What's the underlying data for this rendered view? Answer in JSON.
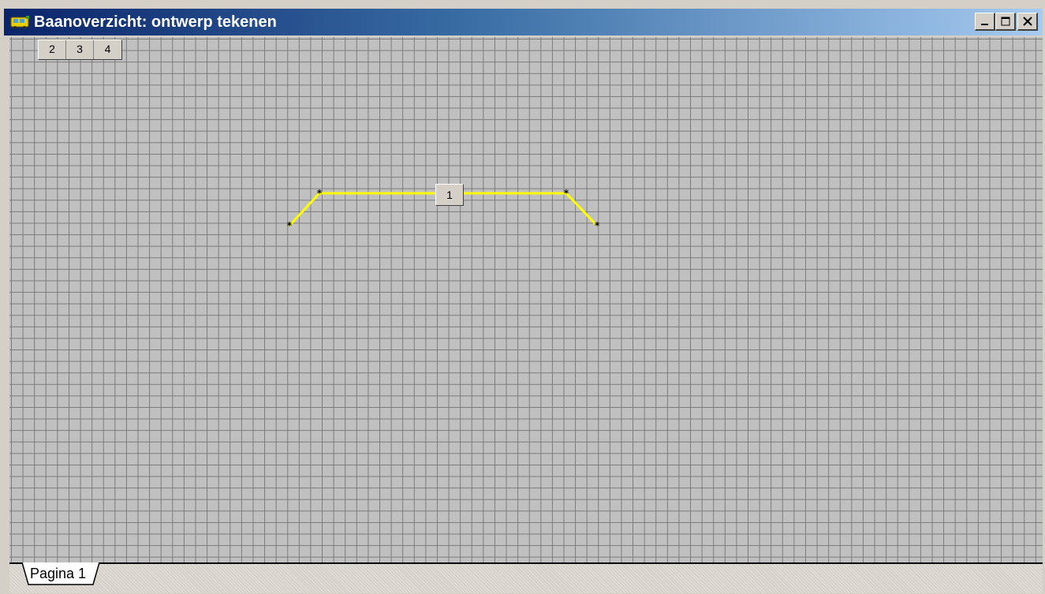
{
  "window": {
    "title": "Baanoverzicht: ontwerp tekenen",
    "minimize_label": "_",
    "maximize_label": "□",
    "close_label": "✕"
  },
  "canvas": {
    "page_buttons": [
      "2",
      "3",
      "4"
    ],
    "track_color": "#ffff00",
    "grid_color": "#7a7a7a",
    "background_color": "#c0c0c0",
    "block_label": "1",
    "node_symbol": "*"
  },
  "sheet_tabs": {
    "active": "Pagina 1"
  }
}
